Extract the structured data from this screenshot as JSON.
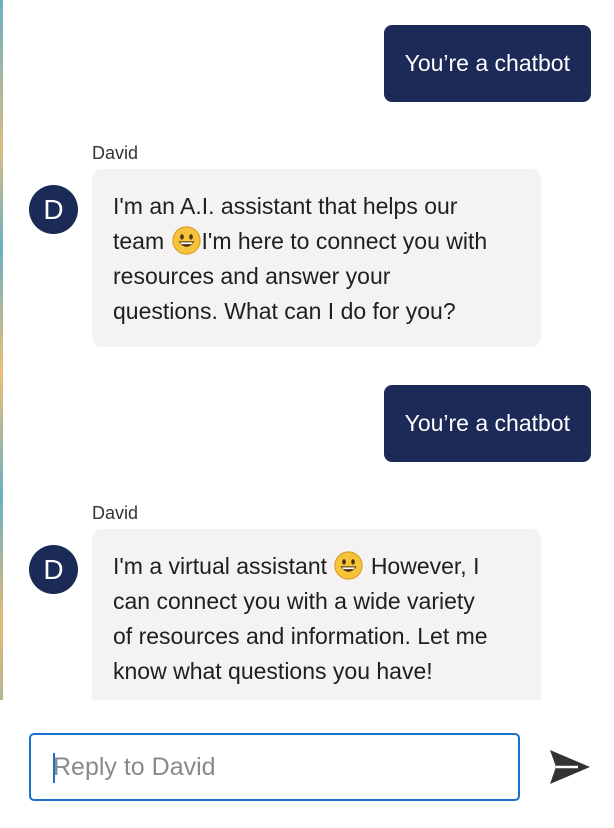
{
  "conversation": {
    "messages": [
      {
        "role": "user",
        "text": "You’re a chatbot"
      },
      {
        "role": "bot",
        "sender": "David",
        "avatar_letter": "D",
        "lines": [
          "I'm an A.I. assistant that helps our",
          "team",
          "I'm here to connect you with",
          "resources and answer your",
          "questions. What can I do for you?"
        ]
      },
      {
        "role": "user",
        "text": "You’re a chatbot"
      },
      {
        "role": "bot",
        "sender": "David",
        "avatar_letter": "D",
        "lines": [
          "I'm a virtual assistant",
          "However, I",
          "can connect you with a wide variety",
          "of resources and information. Let me",
          "know what questions you have!"
        ]
      }
    ]
  },
  "composer": {
    "placeholder": "Reply to David",
    "value": ""
  },
  "icons": {
    "emoji": "grinning-face-icon",
    "send": "send-arrow-icon"
  },
  "colors": {
    "user_bubble": "#1b2a57",
    "bot_bubble": "#f4f2f2",
    "avatar": "#1b2a57",
    "input_border": "#1a73c8",
    "send_icon": "#333333"
  }
}
